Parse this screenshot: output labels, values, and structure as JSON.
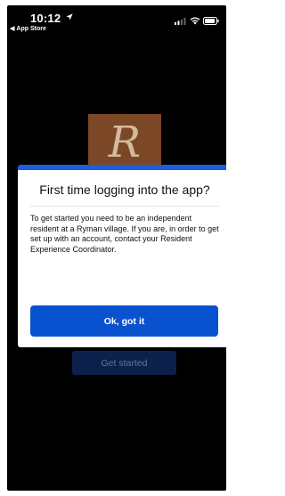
{
  "status_bar": {
    "time": "10:12",
    "back_label": "App Store"
  },
  "background": {
    "logo_letter": "R",
    "get_started_label": "Get started"
  },
  "modal": {
    "title": "First time logging into the app?",
    "body": "To get started you need to be an independent resident at a Ryman village. If you are, in order to get set up with an account, contact your Resident Experience Coordinator.",
    "confirm_label": "Ok, got it"
  },
  "colors": {
    "accent": "#1e5edd",
    "button": "#0952cf",
    "logo_background": "#7b4727",
    "screen_background": "#000000"
  }
}
